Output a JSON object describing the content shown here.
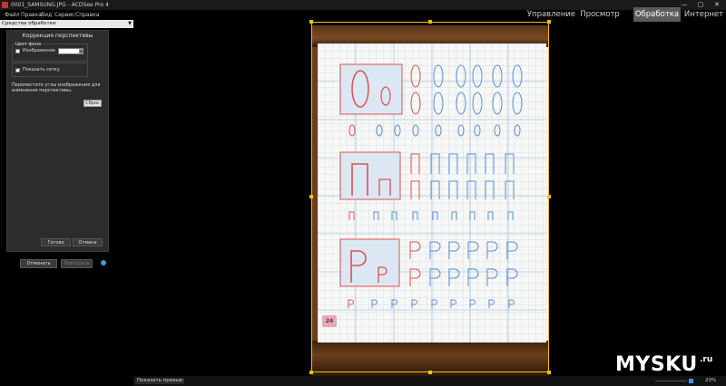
{
  "window": {
    "title": "0001_SAMSUNG.JPG - ACDSee Pro 4",
    "controls": [
      "—",
      "▢",
      "✕"
    ]
  },
  "menu": [
    "Файл",
    "Правка",
    "Вид",
    "Сервис",
    "Справка"
  ],
  "mode_tabs": [
    {
      "label": "Управление",
      "active": false
    },
    {
      "label": "Просмотр",
      "active": false
    },
    {
      "label": "Обработка",
      "active": true
    },
    {
      "label": "Интернет",
      "active": false
    }
  ],
  "panel": {
    "header": "Средства обработки",
    "tool_title": "Коррекция перспективы",
    "bg_color_label": "Цвет фона",
    "image_checkbox": "Изображение",
    "image_checked": false,
    "show_grid_checkbox": "Показать сетку",
    "show_grid_checked": true,
    "hint": "Переместите углы изображения для изменения перспективы.",
    "hint_line1": "Переместите углы изображения для",
    "hint_line2": "изменения перспективы.",
    "reset_button": "Сброс",
    "done_button": "Готово",
    "cancel_button": "Отмена",
    "undo_button": "Отменить",
    "redo_button": "Повторить"
  },
  "status": {
    "preview_toggle": "Показать превью",
    "zoom": "20%"
  },
  "image": {
    "page_number": "24",
    "letters": [
      "О",
      "П",
      "Р"
    ]
  },
  "watermark": {
    "text": "MYSKU",
    "suffix": ".ru"
  },
  "colors": {
    "selection": "#f5c20b",
    "red_ink": "#e05050",
    "blue_ink": "#5b8fd0",
    "active_tab": "#5b5b5b"
  }
}
